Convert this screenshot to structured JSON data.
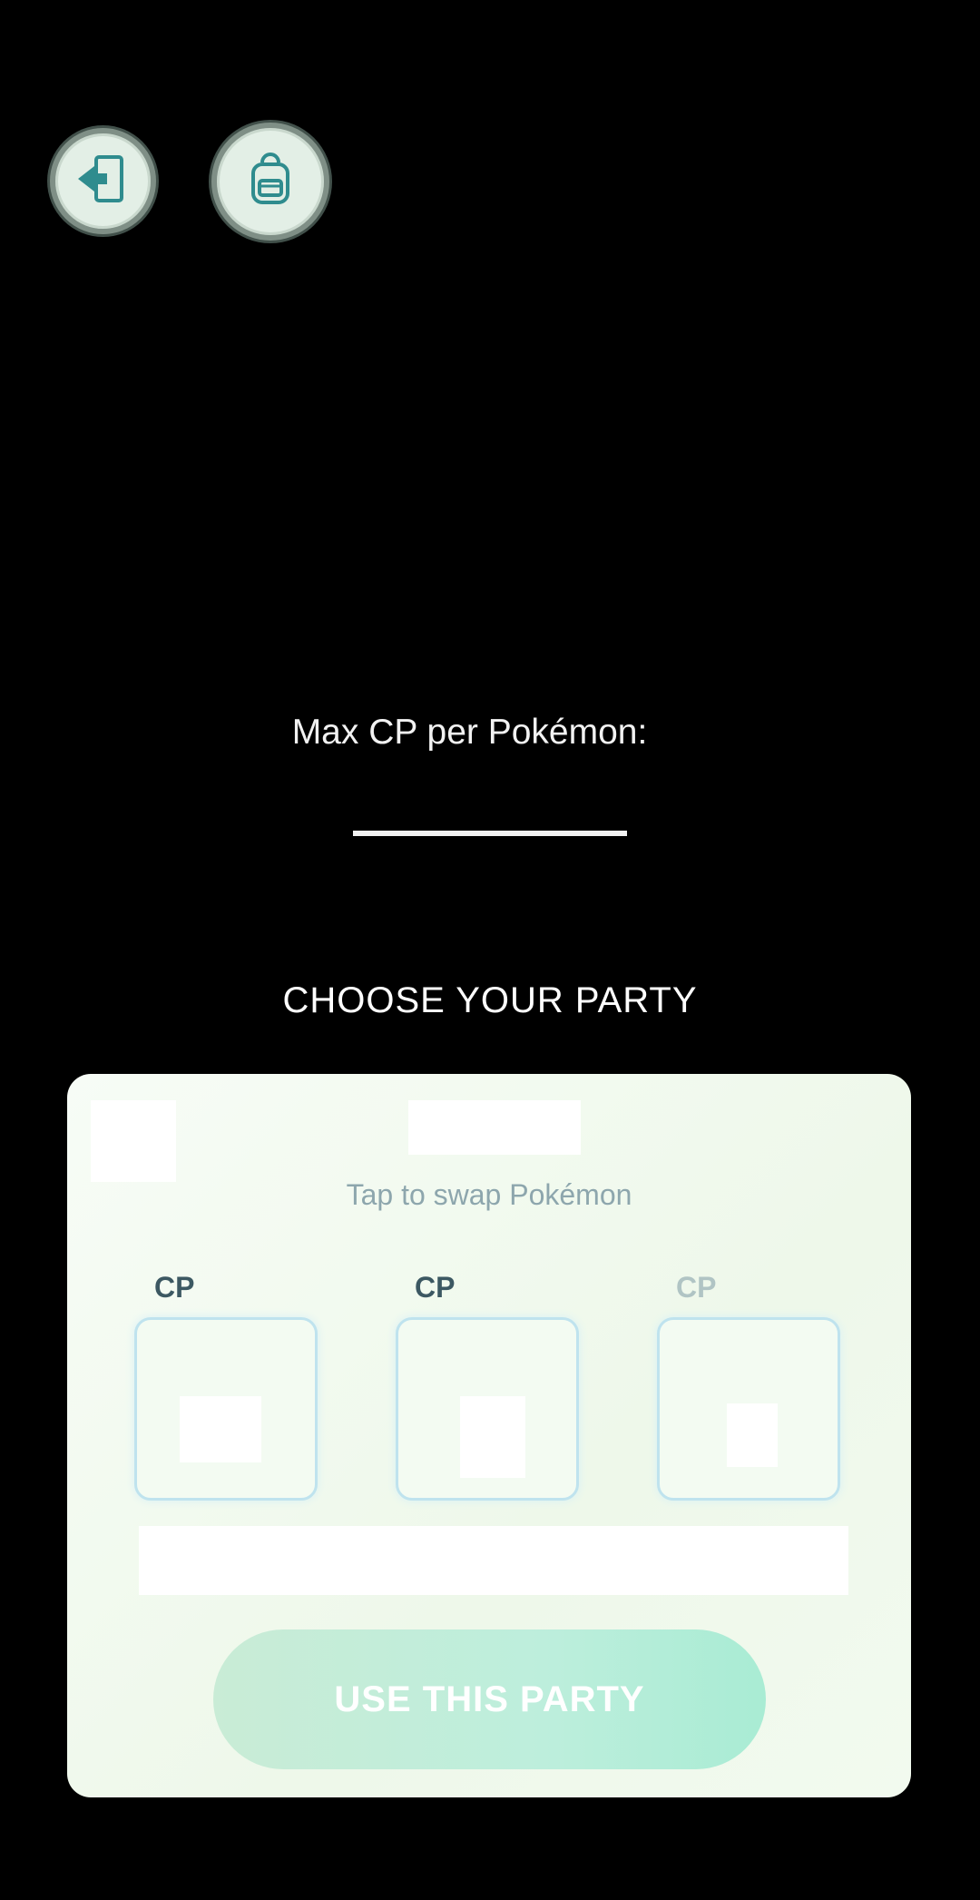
{
  "header": {
    "exit_icon": "exit-door-arrow-icon",
    "bag_icon": "backpack-icon"
  },
  "max_cp": {
    "label": "Max CP per Pokémon:",
    "value": ""
  },
  "party": {
    "title": "CHOOSE YOUR PARTY",
    "hint": "Tap to swap Pokémon",
    "slots": [
      {
        "cp_label": "CP"
      },
      {
        "cp_label": "CP"
      },
      {
        "cp_label": "CP"
      }
    ],
    "use_button_label": "USE THIS PARTY"
  },
  "colors": {
    "accent_teal": "#2f8c8e",
    "button_green": "#bdeedc",
    "card_bg": "#f3faf0"
  }
}
